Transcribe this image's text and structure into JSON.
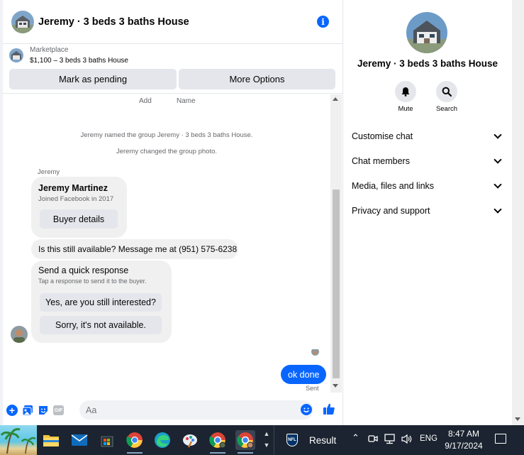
{
  "chat": {
    "title": "Jeremy · 3 beds 3 baths House",
    "marketplace": {
      "label": "Marketplace",
      "listing": "$1,100 – 3 beds 3 baths House",
      "pending_button": "Mark as pending",
      "more_button": "More Options"
    },
    "cut_row": {
      "add": "Add",
      "name": "Name"
    },
    "system_messages": [
      "Jeremy named the group Jeremy · 3 beds 3 baths House.",
      "Jeremy changed the group photo."
    ],
    "sender_name": "Jeremy",
    "buyer_card": {
      "name": "Jeremy Martinez",
      "joined": "Joined Facebook in 2017",
      "button": "Buyer details"
    },
    "message": "Is this still available? Message me at (951) 575-6238",
    "quick_response": {
      "title": "Send a quick response",
      "hint": "Tap a response to send it to the buyer.",
      "yes": "Yes, are you still interested?",
      "no": "Sorry, it's not available."
    },
    "outgoing": "ok done",
    "status": "Sent",
    "composer_placeholder": "Aa",
    "gif_label": "GIF"
  },
  "side": {
    "title": "Jeremy · 3 beds 3 baths House",
    "actions": {
      "mute": "Mute",
      "search": "Search"
    },
    "sections": [
      "Customise chat",
      "Chat members",
      "Media, files and links",
      "Privacy and support"
    ]
  },
  "taskbar": {
    "result": "Result",
    "nfl": "NFL",
    "lang": "ENG",
    "time": "8:47 AM",
    "date": "9/17/2024"
  },
  "colors": {
    "accent": "#0866ff",
    "bubble": "#f0f0f0",
    "button": "#e4e6eb",
    "taskbar": "#1b2430"
  },
  "icons": [
    "info-icon",
    "bell-icon",
    "magnifier-icon",
    "chevron-down-icon",
    "plus-icon",
    "image-icon",
    "sticker-icon",
    "gif-icon",
    "emoji-icon",
    "thumbs-up-icon"
  ]
}
